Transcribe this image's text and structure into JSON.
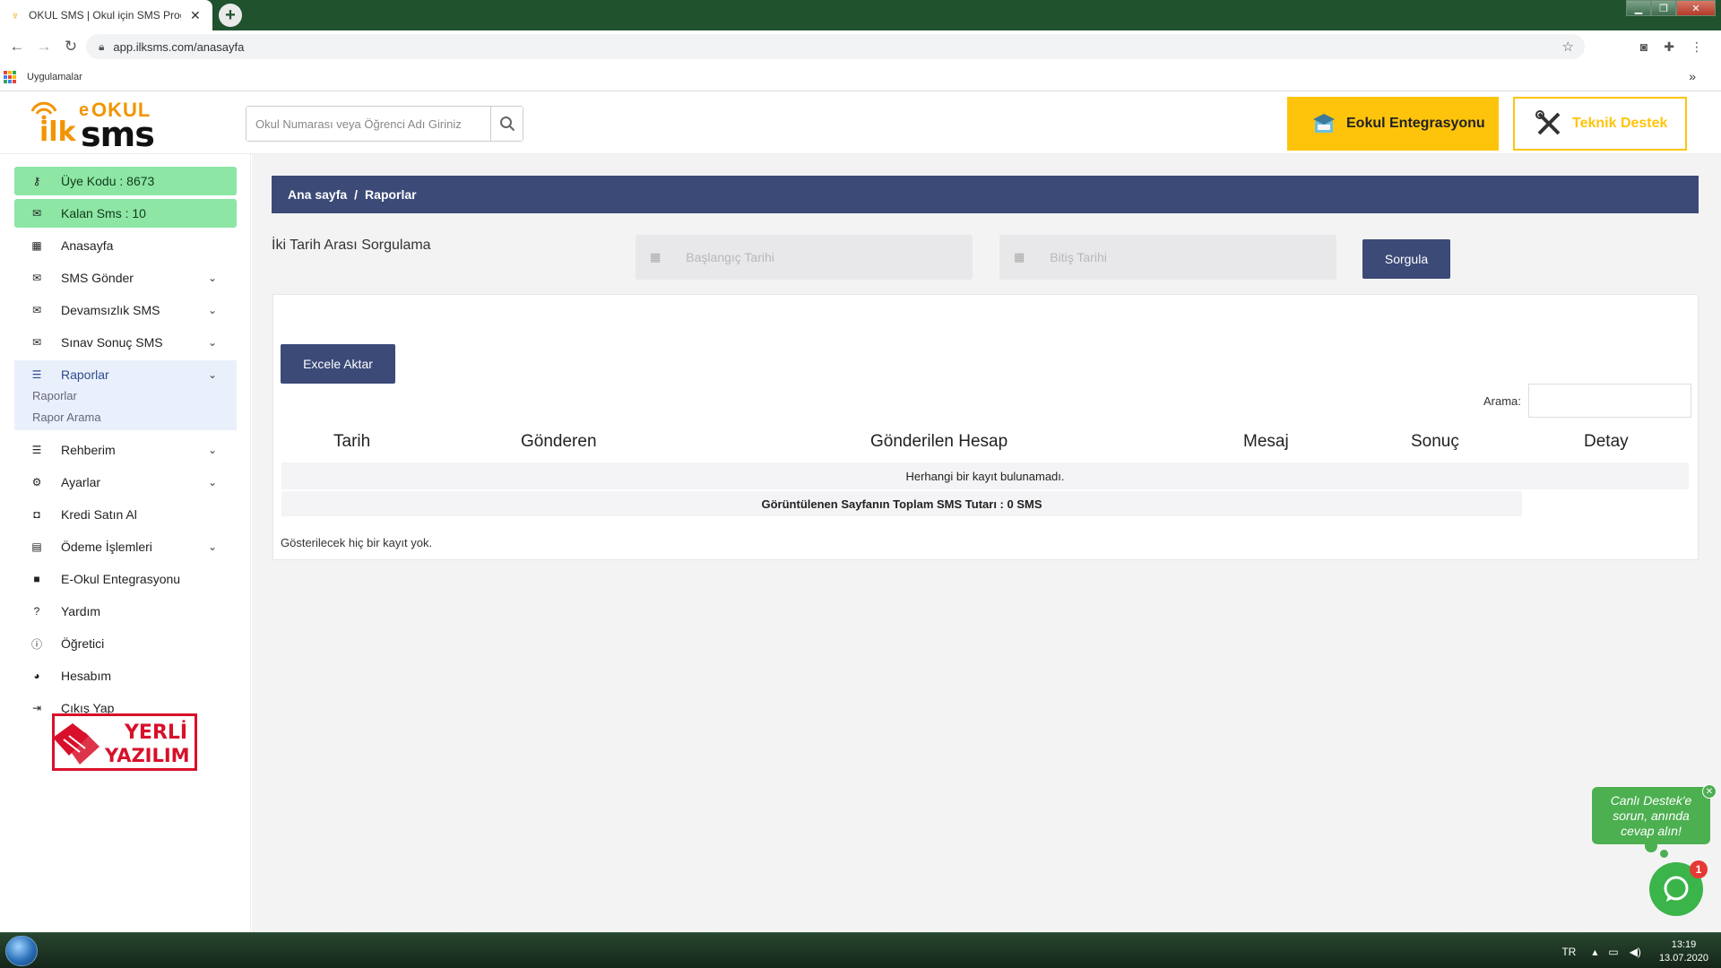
{
  "browser": {
    "tab_title": "OKUL SMS | Okul için SMS Programı",
    "new_tab_glyph": "+",
    "tab_close_glyph": "✕",
    "url": "app.ilksms.com/anasayfa",
    "bookmarks_label": "Uygulamalar",
    "more_glyph": "»"
  },
  "header": {
    "logo": {
      "e": "e",
      "okul": "OKUL",
      "ilk": "ilk",
      "sms": "sms"
    },
    "search_placeholder": "Okul Numarası veya Öğrenci Adı Giriniz",
    "eokul_button": "Eokul Entegrasyonu",
    "teknik_button": "Teknik Destek"
  },
  "sidebar": {
    "uye_kodu": "Üye Kodu : 8673",
    "kalan_sms": "Kalan Sms : 10",
    "items": [
      {
        "label": "Anasayfa",
        "icon": "grid-icon",
        "chevron": false
      },
      {
        "label": "SMS Gönder",
        "icon": "envelope-icon",
        "chevron": true
      },
      {
        "label": "Devamsızlık SMS",
        "icon": "envelope-icon",
        "chevron": true
      },
      {
        "label": "Sınav Sonuç SMS",
        "icon": "envelope-icon",
        "chevron": true
      },
      {
        "label": "Raporlar",
        "icon": "list-icon",
        "chevron": true,
        "active": true
      },
      {
        "label": "Rehberim",
        "icon": "list-icon",
        "chevron": true
      },
      {
        "label": "Ayarlar",
        "icon": "gear-icon",
        "chevron": true
      },
      {
        "label": "Kredi Satın Al",
        "icon": "money-icon",
        "chevron": false
      },
      {
        "label": "Ödeme İşlemleri",
        "icon": "card-icon",
        "chevron": true
      },
      {
        "label": "E-Okul Entegrasyonu",
        "icon": "folder-icon",
        "chevron": false
      },
      {
        "label": "Yardım",
        "icon": "help-icon",
        "chevron": false
      },
      {
        "label": "Öğretici",
        "icon": "info-icon",
        "chevron": false
      },
      {
        "label": "Hesabım",
        "icon": "user-icon",
        "chevron": false
      },
      {
        "label": "Çıkış Yap",
        "icon": "logout-icon",
        "chevron": false
      }
    ],
    "sub_items": [
      "Raporlar",
      "Rapor Arama"
    ],
    "badge": {
      "line1": "YERLİ",
      "line2": "YAZILIM"
    }
  },
  "main": {
    "breadcrumb": {
      "home": "Ana sayfa",
      "separator": "/",
      "current": "Raporlar"
    },
    "query_label": "İki Tarih Arası Sorgulama",
    "start_date_placeholder": "Başlangıç Tarihi",
    "end_date_placeholder": "Bitiş Tarihi",
    "query_button": "Sorgula",
    "export_button": "Excele Aktar",
    "search_label": "Arama:",
    "table": {
      "columns": [
        "Tarih",
        "Gönderen",
        "Gönderilen Hesap",
        "Mesaj",
        "Sonuç",
        "Detay"
      ],
      "no_records": "Herhangi bir kayıt bulunamadı.",
      "total_row": "Görüntülenen Sayfanın Toplam SMS Tutarı : 0 SMS"
    },
    "empty_message": "Gösterilecek hiç bir kayıt yok."
  },
  "chat": {
    "bubble_text": "Canlı Destek'e sorun, anında cevap alın!",
    "badge_count": "1"
  },
  "taskbar": {
    "lang": "TR",
    "time": "13:19",
    "date": "13.07.2020"
  },
  "colors": {
    "accent_navy": "#3c4a78",
    "green_badge": "#8de6a4",
    "yellow_button": "#fec40c",
    "chat_green": "#4caf50"
  }
}
